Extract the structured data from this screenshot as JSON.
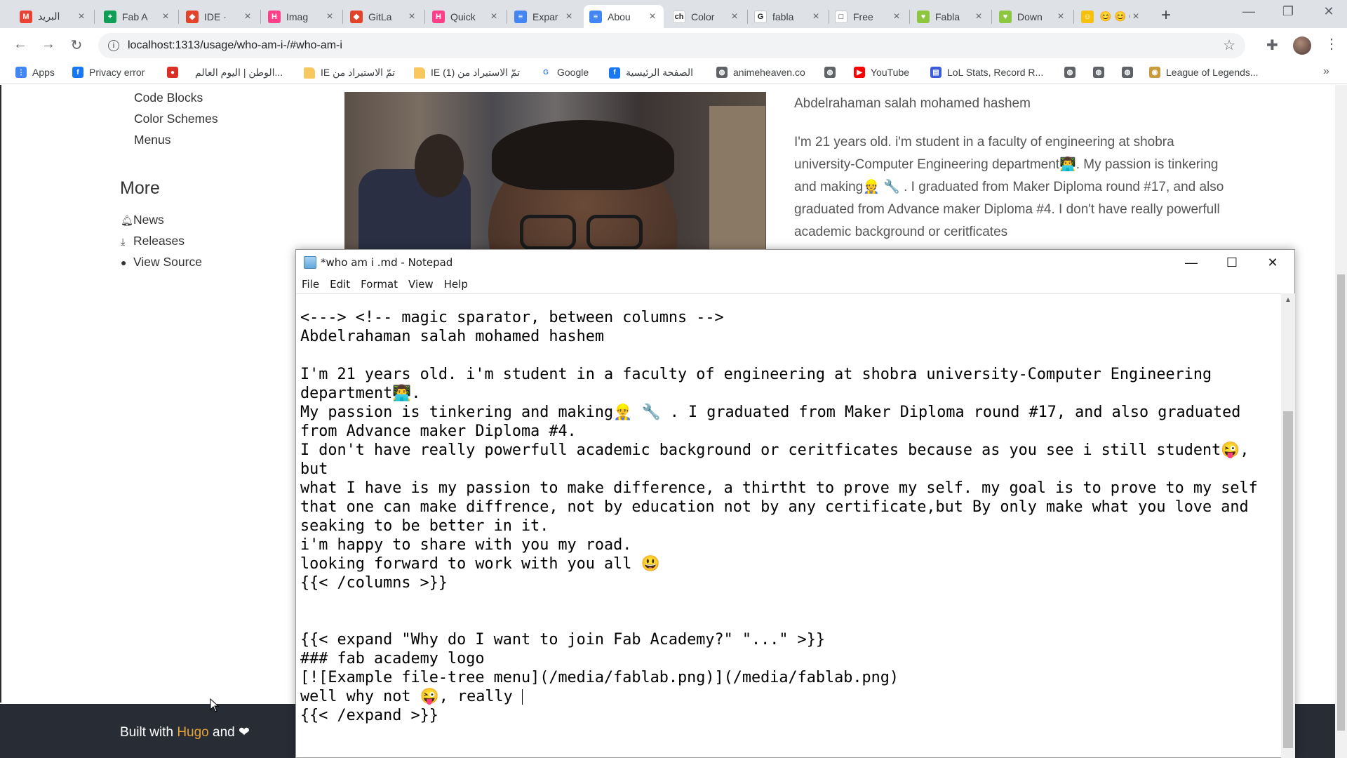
{
  "browser": {
    "tabs": [
      {
        "title": "البريد",
        "icon": "gmail-icon",
        "color": "#ea4335",
        "glyph": "M"
      },
      {
        "title": "Fab A",
        "icon": "sheets-icon",
        "color": "#0f9d58",
        "glyph": "+"
      },
      {
        "title": "IDE · ",
        "icon": "gitlab-icon",
        "color": "#e24329",
        "glyph": "◆"
      },
      {
        "title": "Imag",
        "icon": "hugo-icon",
        "color": "#ff4088",
        "glyph": "H"
      },
      {
        "title": "GitLa",
        "icon": "gitlab-icon",
        "color": "#e24329",
        "glyph": "◆"
      },
      {
        "title": "Quick",
        "icon": "hugo-icon",
        "color": "#ff4088",
        "glyph": "H"
      },
      {
        "title": "Expar",
        "icon": "doc-icon",
        "color": "#4285f4",
        "glyph": "≡"
      },
      {
        "title": "Abou",
        "icon": "doc-icon",
        "color": "#4285f4",
        "glyph": "≡"
      },
      {
        "title": "Color",
        "icon": "ch-icon",
        "color": "#ffffff",
        "glyph": "ch"
      },
      {
        "title": "fabla",
        "icon": "google-icon",
        "color": "#ffffff",
        "glyph": "G"
      },
      {
        "title": "Free",
        "icon": "frame-icon",
        "color": "#ffffff",
        "glyph": "□"
      },
      {
        "title": "Fabla",
        "icon": "fablab-icon",
        "color": "#8dc63f",
        "glyph": "♥"
      },
      {
        "title": "Down",
        "icon": "fablab-icon",
        "color": "#8dc63f",
        "glyph": "♥"
      },
      {
        "title": "😊 😊 G",
        "icon": "emoji-icon",
        "color": "#f4c20d",
        "glyph": "☺"
      }
    ],
    "active_tab_index": 7,
    "address": "localhost:1313/usage/who-am-i-/#who-am-i",
    "bookmarks": [
      {
        "label": "Apps",
        "icon": "apps-icon",
        "color": "#4285f4",
        "glyph": "⋮"
      },
      {
        "label": "Privacy error",
        "icon": "facebook-icon",
        "color": "#1877f2",
        "glyph": "f"
      },
      {
        "label": "",
        "icon": "red-icon",
        "color": "#d93025",
        "glyph": "●"
      },
      {
        "label": "الوطن | اليوم العالم...",
        "icon": "",
        "color": "",
        "glyph": ""
      },
      {
        "label": "IE تمّ الاستيراد من",
        "icon": "folder-icon",
        "color": "#f6c85f",
        "glyph": ""
      },
      {
        "label": "IE (1) تمّ الاستيراد من",
        "icon": "folder-icon",
        "color": "#f6c85f",
        "glyph": ""
      },
      {
        "label": "Google",
        "icon": "google-icon",
        "color": "#ffffff",
        "glyph": "G"
      },
      {
        "label": "الصفحة الرئيسية",
        "icon": "facebook-icon",
        "color": "#1877f2",
        "glyph": "f"
      },
      {
        "label": "animeheaven.co",
        "icon": "globe-icon",
        "color": "#5f6368",
        "glyph": "◍"
      },
      {
        "label": "",
        "icon": "globe-icon",
        "color": "#5f6368",
        "glyph": "◍"
      },
      {
        "label": "YouTube",
        "icon": "youtube-icon",
        "color": "#ff0000",
        "glyph": "▶"
      },
      {
        "label": "LoL Stats, Record R...",
        "icon": "lol-stats-icon",
        "color": "#3b5bdb",
        "glyph": "▤"
      },
      {
        "label": "",
        "icon": "globe-icon",
        "color": "#5f6368",
        "glyph": "◍"
      },
      {
        "label": "",
        "icon": "globe-icon",
        "color": "#5f6368",
        "glyph": "◍"
      },
      {
        "label": "",
        "icon": "globe-icon",
        "color": "#5f6368",
        "glyph": "◍"
      },
      {
        "label": "League of Legends...",
        "icon": "lol-icon",
        "color": "#c89b3c",
        "glyph": "◉"
      }
    ]
  },
  "page": {
    "sidebar": {
      "links": [
        "Code Blocks",
        "Color Schemes",
        "Menus"
      ],
      "more_heading": "More",
      "more_links": [
        "News",
        "Releases",
        "View Source"
      ]
    },
    "about_name": "Abdelrahaman salah mohamed hashem",
    "about_text": "I'm 21 years old. i'm student in a faculty of engineering at shobra university-Computer Engineering department👨‍💻. My passion is tinkering and making👷 🔧 . I graduated from Maker Diploma round #17, and also graduated from Advance maker Diploma #4. I don't have really powerfull academic background or ceritficates",
    "footer": {
      "prefix": "Built with ",
      "hugo": "Hugo",
      "suffix": " and ❤"
    }
  },
  "notepad": {
    "title": "*who am i .md - Notepad",
    "menu": [
      "File",
      "Edit",
      "Format",
      "View",
      "Help"
    ],
    "lines": [
      "<---> <!-- magic sparator, between columns -->",
      "Abdelrahaman salah mohamed hashem",
      "",
      "I'm 21 years old. i'm student in a faculty of engineering at shobra university-Computer Engineering",
      "department👨‍💻.",
      "My passion is tinkering and making👷‍♂ 🔧 . I graduated from Maker Diploma round #17, and also graduated",
      "from Advance maker Diploma #4.",
      "I don't have really powerfull academic background or ceritficates because as you see i still student😜,",
      "but",
      "what I have is my passion to make difference, a thirtht to prove my self. my goal is to prove to my self",
      "that one can make diffrence, not by education not by any certificate,but By only make what you love and",
      "seaking to be better in it.",
      "i'm happy to share with you my road.",
      "looking forward to work with you all 😃",
      "{{< /columns >}}",
      "",
      "",
      "{{< expand \"Why do I want to join Fab Academy?\" \"...\" >}}",
      "### fab academy logo",
      "[![Example file-tree menu](/media/fablab.png)](/media/fablab.png)",
      "well why not 😜, really ",
      "{{< /expand >}}"
    ]
  }
}
